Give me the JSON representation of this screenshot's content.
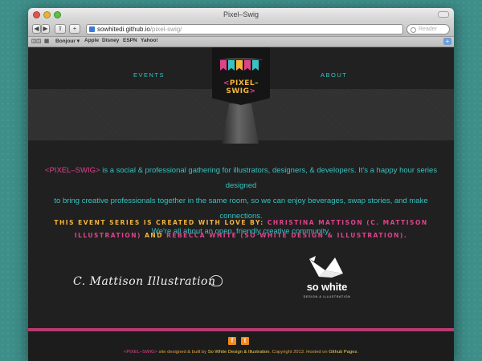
{
  "window": {
    "title": "Pixel–Swig"
  },
  "toolbar": {
    "url_host": "sowhitedi.github.io",
    "url_path": "/pixel-swig/",
    "search_placeholder": "Reader"
  },
  "bookmarks": [
    "Bonjour ▾",
    "Apple",
    "Disney",
    "ESPN",
    "Yahoo!"
  ],
  "nav": {
    "events": "EVENTS",
    "about": "ABOUT"
  },
  "logo": {
    "left": "<",
    "name": "PIXEL–SWIG",
    "right": ">"
  },
  "intro": {
    "brand": "<PIXEL–SWIG>",
    "text1": " is a social & professional gathering for illustrators, designers, & developers. It's a happy hour series designed",
    "text2": "to bring creative professionals together in the same room, so we can enjoy beverages, swap stories, and make connections.",
    "text3": "We're all about an open, friendly creative community."
  },
  "credit": {
    "prefix": "THIS EVENT SERIES IS CREATED WITH LOVE BY:",
    "name1": "CHRISTINA MATTISON (C. MATTISON",
    "name1b": "ILLUSTRATION)",
    "and": "AND",
    "name2": "REBECCA WHITE (SO WHITE DESIGN & ILLUSTRATION)."
  },
  "partners": {
    "mattison_signature": "C. Mattison Illustration",
    "sowhite_name": "so white",
    "sowhite_sub": "DESIGN & ILLUSTRATION"
  },
  "footer": {
    "brand": "<PIXEL–SWIG>",
    "text1": " site designed & built by ",
    "designer": "So White Design & Illustration",
    "text2": ". Copyright 2013. Hosted on ",
    "host": "Github Pages",
    "text3": "."
  },
  "colors": {
    "teal": "#38c2c2",
    "pink": "#e0428a",
    "orange": "#f4b43c",
    "background": "#3e8e8a"
  }
}
